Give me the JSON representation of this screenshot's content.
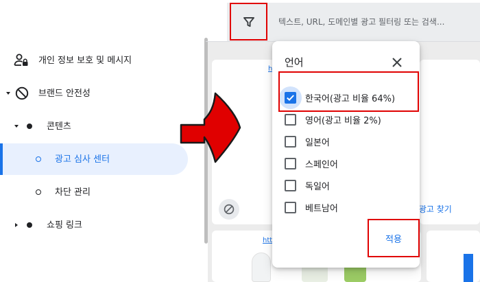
{
  "sidebar": {
    "items": [
      {
        "label": "개인 정보 보호 및 메시지",
        "icon": "user-lock-icon"
      },
      {
        "label": "브랜드 안전성",
        "icon": "block-icon",
        "expander": "chevron-down"
      },
      {
        "label": "콘텐츠",
        "icon": "filled-dot-icon",
        "expander": "chevron-down"
      },
      {
        "label": "광고 심사 센터",
        "icon": "ring-dot-icon",
        "active": true
      },
      {
        "label": "차단 관리",
        "icon": "ring-dot-icon"
      },
      {
        "label": "쇼핑 링크",
        "icon": "filled-dot-icon",
        "expander": "chevron-right"
      }
    ]
  },
  "search": {
    "filter_icon": "filter-icon",
    "placeholder": "텍스트, URL, 도메인별 광고 필터링 또는 검색..."
  },
  "background": {
    "card_link_top": "h",
    "card_link_bottom": "htt",
    "peek_text": "련 광고 찾기"
  },
  "dropdown": {
    "title": "언어",
    "close_icon": "close-icon",
    "options": [
      {
        "label": "한국어(광고 비율 64%)",
        "checked": true
      },
      {
        "label": "영어(광고 비율 2%)",
        "checked": false
      },
      {
        "label": "일본어",
        "checked": false
      },
      {
        "label": "스페인어",
        "checked": false
      },
      {
        "label": "독일어",
        "checked": false
      },
      {
        "label": "베트남어",
        "checked": false
      }
    ],
    "apply_label": "적용"
  },
  "colors": {
    "accent": "#1a73e8",
    "annotation_red": "#e00000",
    "active_bg": "#e8f0fe"
  }
}
